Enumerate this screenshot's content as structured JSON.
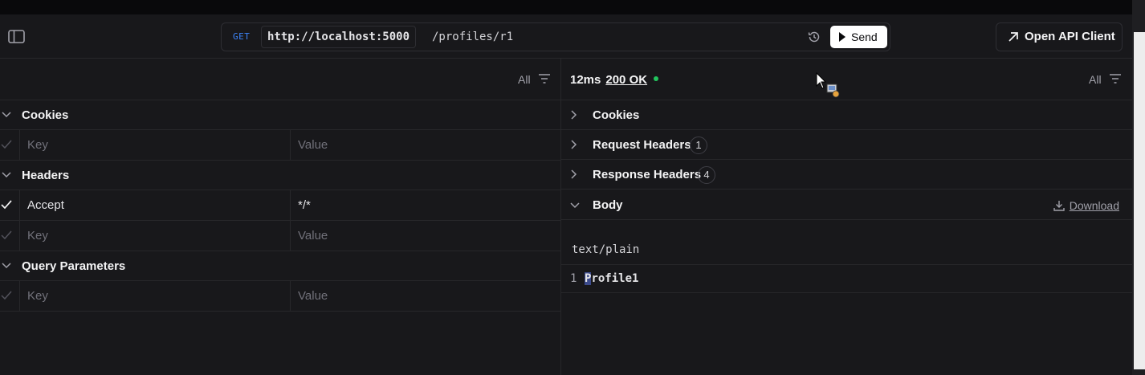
{
  "request": {
    "method": "GET",
    "host": "http://localhost:5000",
    "path": "/profiles/r1",
    "send_label": "Send",
    "open_api_label": "Open API Client"
  },
  "left_panel": {
    "filter_label": "All",
    "sections": {
      "cookies": {
        "title": "Cookies"
      },
      "headers": {
        "title": "Headers"
      },
      "query": {
        "title": "Query Parameters"
      }
    },
    "cookie_row": {
      "key_placeholder": "Key",
      "value_placeholder": "Value"
    },
    "header_rows": [
      {
        "key": "Accept",
        "value": "*/*",
        "checked": true
      },
      {
        "key_placeholder": "Key",
        "value_placeholder": "Value",
        "checked": false
      }
    ],
    "query_row": {
      "key_placeholder": "Key",
      "value_placeholder": "Value"
    }
  },
  "response": {
    "time": "12ms",
    "status": "200 OK",
    "status_color": "#22c55e",
    "filter_label": "All",
    "sections": {
      "cookies": {
        "title": "Cookies"
      },
      "request_headers": {
        "title": "Request Headers",
        "count": "1"
      },
      "response_headers": {
        "title": "Response Headers",
        "count": "4"
      },
      "body": {
        "title": "Body",
        "download_label": "Download"
      }
    },
    "content_type": "text/plain",
    "body_lines": [
      {
        "number": "1",
        "first_char": "P",
        "rest": "rofile1"
      }
    ]
  },
  "colors": {
    "accent": "#3b82f6",
    "background": "#18181b",
    "success": "#22c55e"
  }
}
